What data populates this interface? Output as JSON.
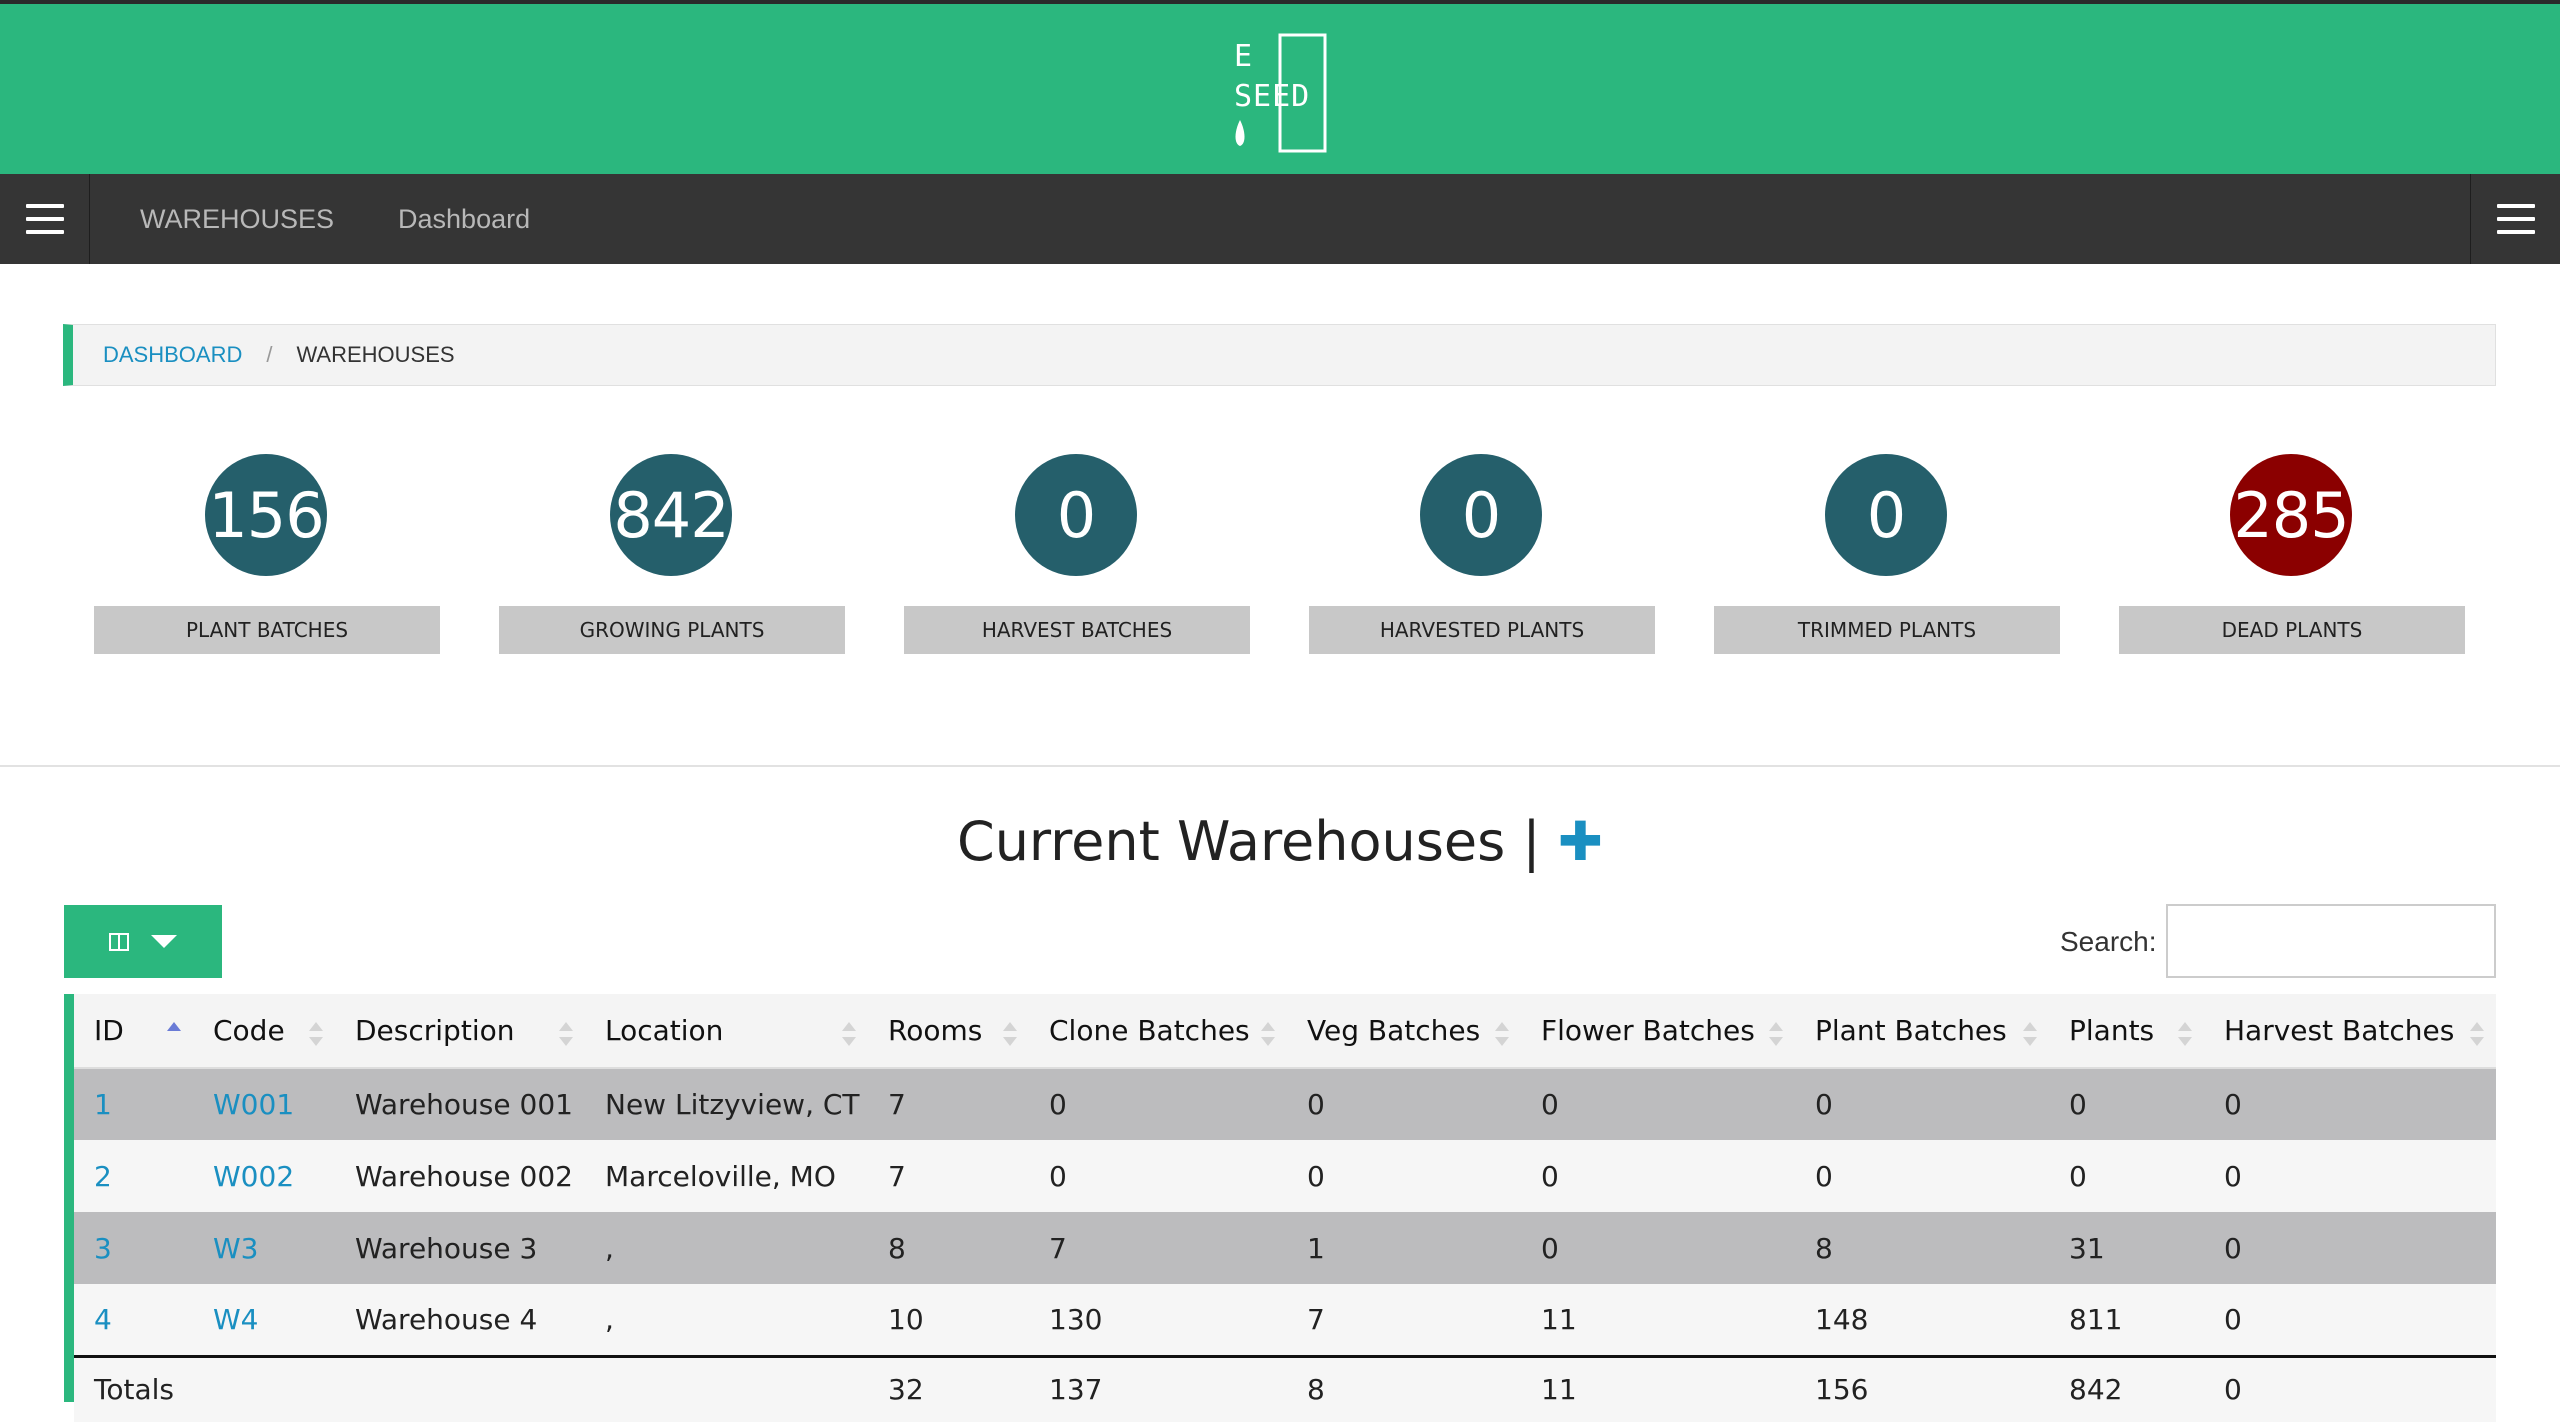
{
  "header": {
    "logo_top": "E",
    "logo_bottom": "SEED"
  },
  "nav": {
    "links": [
      "WAREHOUSES",
      "Dashboard"
    ]
  },
  "breadcrumb": {
    "home": "DASHBOARD",
    "separator": "/",
    "current": "WAREHOUSES"
  },
  "stats": [
    {
      "value": "156",
      "label": "PLANT BATCHES"
    },
    {
      "value": "842",
      "label": "GROWING PLANTS"
    },
    {
      "value": "0",
      "label": "HARVEST BATCHES"
    },
    {
      "value": "0",
      "label": "HARVESTED PLANTS"
    },
    {
      "value": "0",
      "label": "TRIMMED PLANTS"
    },
    {
      "value": "285",
      "label": "DEAD PLANTS"
    }
  ],
  "section": {
    "title": "Current Warehouses |",
    "add_symbol": "✚"
  },
  "search": {
    "label": "Search:",
    "value": ""
  },
  "table": {
    "columns": [
      "ID",
      "Code",
      "Description",
      "Location",
      "Rooms",
      "Clone Batches",
      "Veg Batches",
      "Flower Batches",
      "Plant Batches",
      "Plants",
      "Harvest Batches"
    ],
    "rows": [
      [
        "1",
        "W001",
        "Warehouse 001",
        "New Litzyview, CT",
        "7",
        "0",
        "0",
        "0",
        "0",
        "0",
        "0"
      ],
      [
        "2",
        "W002",
        "Warehouse 002",
        "Marceloville, MO",
        "7",
        "0",
        "0",
        "0",
        "0",
        "0",
        "0"
      ],
      [
        "3",
        "W3",
        "Warehouse 3",
        ",",
        "8",
        "7",
        "1",
        "0",
        "8",
        "31",
        "0"
      ],
      [
        "4",
        "W4",
        "Warehouse 4",
        ",",
        "10",
        "130",
        "7",
        "11",
        "148",
        "811",
        "0"
      ]
    ],
    "totals": [
      "Totals",
      "",
      "",
      "",
      "32",
      "137",
      "8",
      "11",
      "156",
      "842",
      "0"
    ]
  },
  "colors": {
    "brand_green": "#2bb77e",
    "nav_dark": "#353535",
    "stat_teal": "#255f6b",
    "stat_red": "#8b0000",
    "link_blue": "#1a8fc1"
  }
}
